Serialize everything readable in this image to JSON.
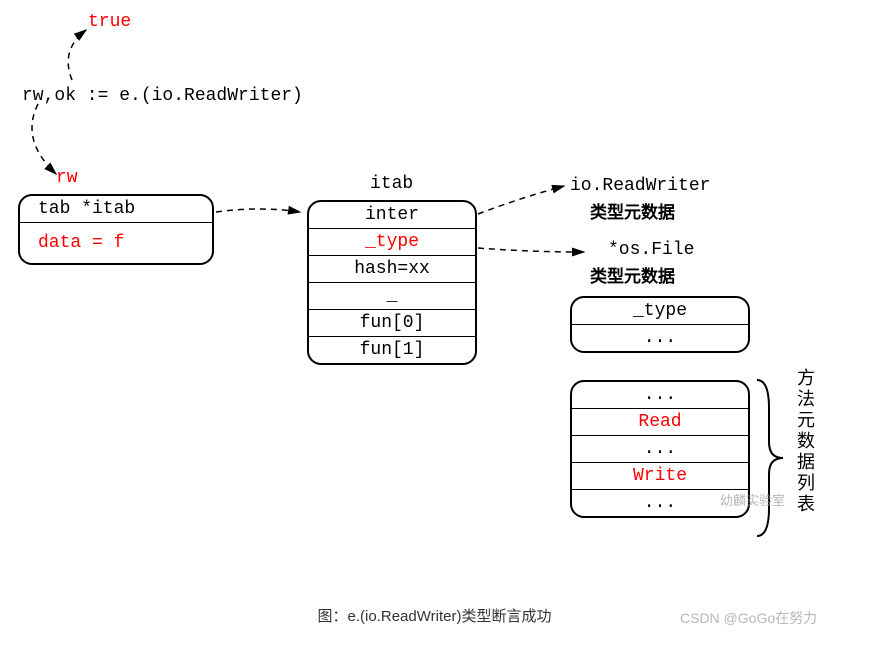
{
  "top": {
    "true_label": "true",
    "code": "rw,ok := e.(io.ReadWriter)",
    "rw_label": "rw"
  },
  "iface_box": {
    "row1": "tab *itab",
    "row2": "data = f"
  },
  "itab": {
    "title": "itab",
    "rows": [
      "inter",
      "_type",
      "hash=xx",
      "_",
      "fun[0]",
      "fun[1]"
    ]
  },
  "right": {
    "io_label": "io.ReadWriter",
    "io_sub": "类型元数据",
    "os_label": "*os.File",
    "os_sub": "类型元数据"
  },
  "type_box": {
    "rows": [
      "_type",
      "..."
    ]
  },
  "methods_box": {
    "rows": [
      "...",
      "Read",
      "...",
      "Write",
      "..."
    ]
  },
  "methods_label": "方法元数据列表",
  "caption": "图：e.(io.ReadWriter)类型断言成功",
  "watermark1": "幼麟实验室",
  "watermark2": "CSDN @GoGo在努力"
}
